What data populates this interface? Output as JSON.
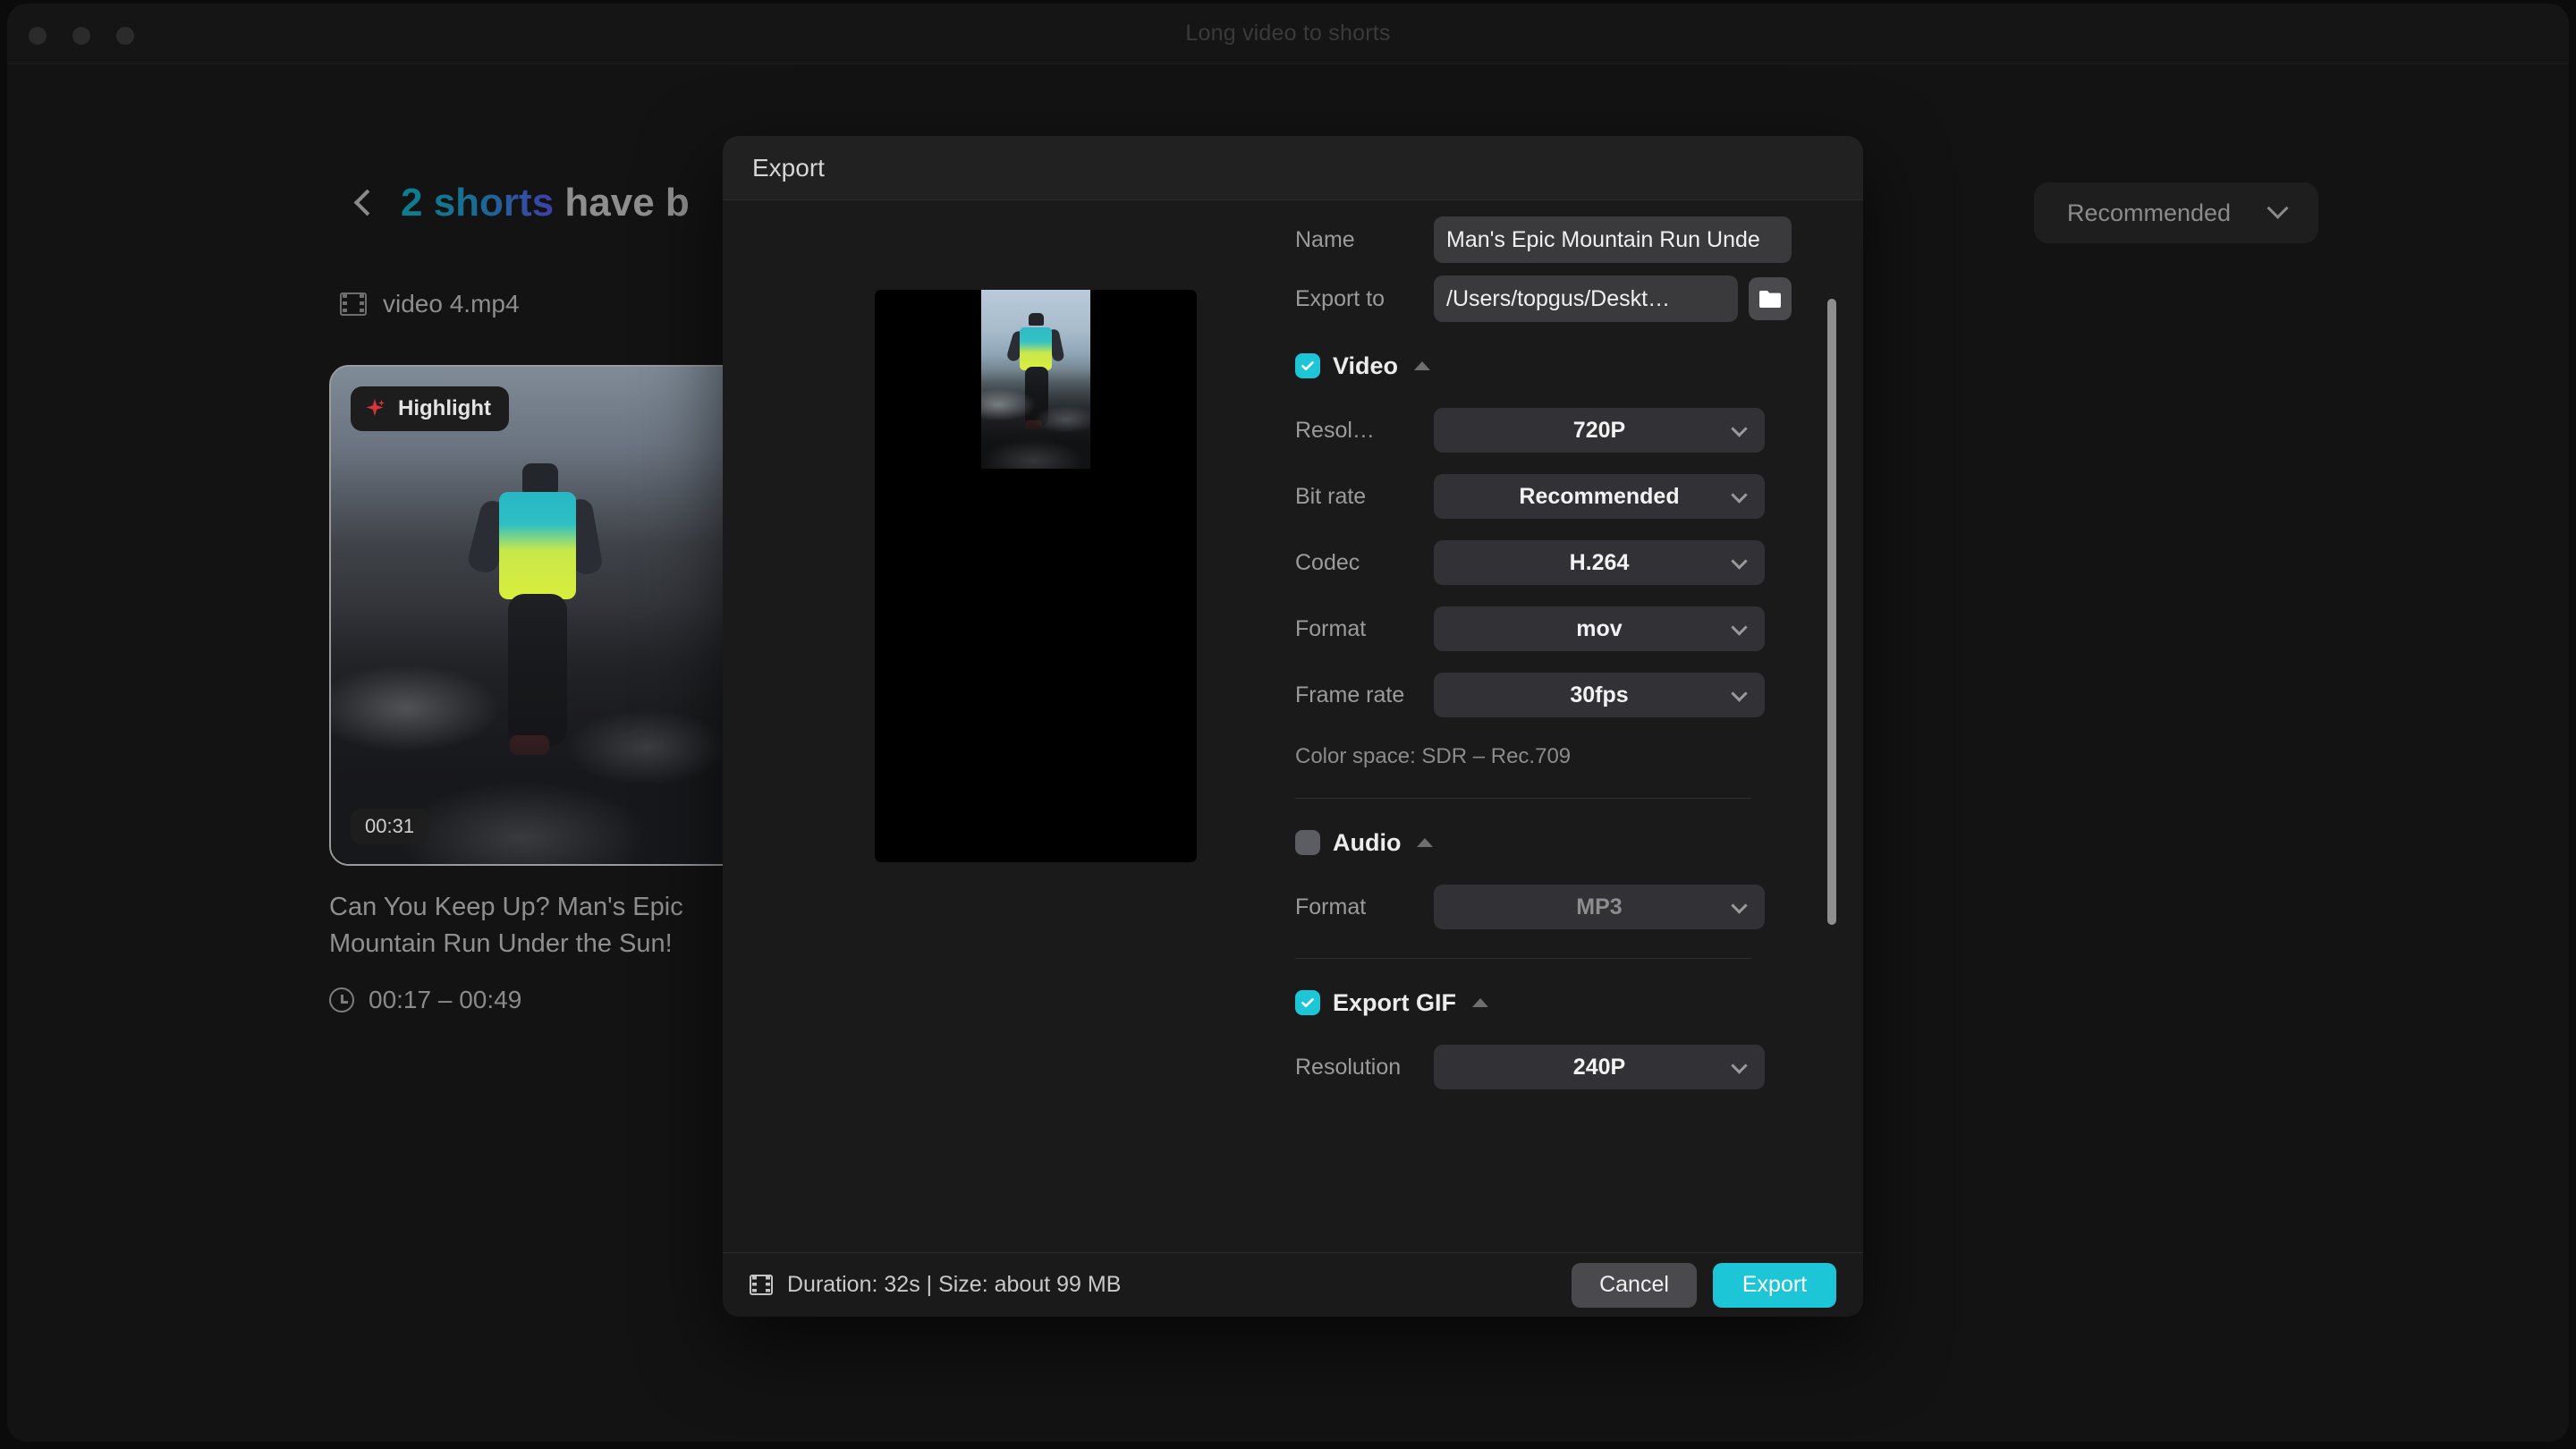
{
  "window": {
    "title": "Long video to shorts",
    "traffic_lights": [
      "close",
      "minimize",
      "zoom"
    ]
  },
  "header": {
    "back_icon": "chevron-left-icon",
    "title_highlight": "2 shorts",
    "title_rest": " have b",
    "file_icon": "film-icon",
    "file_name": "video 4.mp4",
    "sort_dropdown": {
      "label": "Recommended",
      "chevron": "chevron-down-icon"
    }
  },
  "short_card": {
    "badge": {
      "icon": "sparkle-icon",
      "label": "Highlight",
      "icon_color": "#d8343c"
    },
    "duration_badge": "00:31",
    "caption": "Can You Keep Up? Man's Epic Mountain Run Under the Sun!",
    "time_icon": "clock-icon",
    "time_range": "00:17 – 00:49"
  },
  "modal": {
    "title": "Export",
    "preview": {
      "aspect": "9:16",
      "background": "#000000"
    },
    "fields": {
      "name_label": "Name",
      "name_value": "Man's Epic Mountain Run Unde",
      "name_placeholder": "Enter file name",
      "export_to_label": "Export to",
      "export_to_value": "/Users/topgus/Deskt…",
      "export_to_placeholder": "Choose a folder",
      "folder_icon": "folder-icon"
    },
    "video_section": {
      "title": "Video",
      "checked": true,
      "caret": "caret-up-icon",
      "rows": [
        {
          "label": "Resol…",
          "value": "720P"
        },
        {
          "label": "Bit rate",
          "value": "Recommended"
        },
        {
          "label": "Codec",
          "value": "H.264"
        },
        {
          "label": "Format",
          "value": "mov"
        },
        {
          "label": "Frame rate",
          "value": "30fps"
        }
      ],
      "color_space": "Color space: SDR – Rec.709"
    },
    "audio_section": {
      "title": "Audio",
      "checked": false,
      "caret": "caret-up-icon",
      "rows": [
        {
          "label": "Format",
          "value": "MP3"
        }
      ]
    },
    "gif_section": {
      "title": "Export GIF",
      "checked": true,
      "caret": "caret-up-icon",
      "rows": [
        {
          "label": "Resolution",
          "value": "240P"
        }
      ]
    },
    "footer": {
      "meta_icon": "film-icon",
      "meta_text": "Duration: 32s | Size: about 99 MB",
      "cancel_label": "Cancel",
      "export_label": "Export"
    }
  },
  "colors": {
    "accent": "#1dc6d6",
    "badge_red": "#d8343c",
    "modal_bg": "#1a1a1a",
    "app_bg": "#131313"
  }
}
